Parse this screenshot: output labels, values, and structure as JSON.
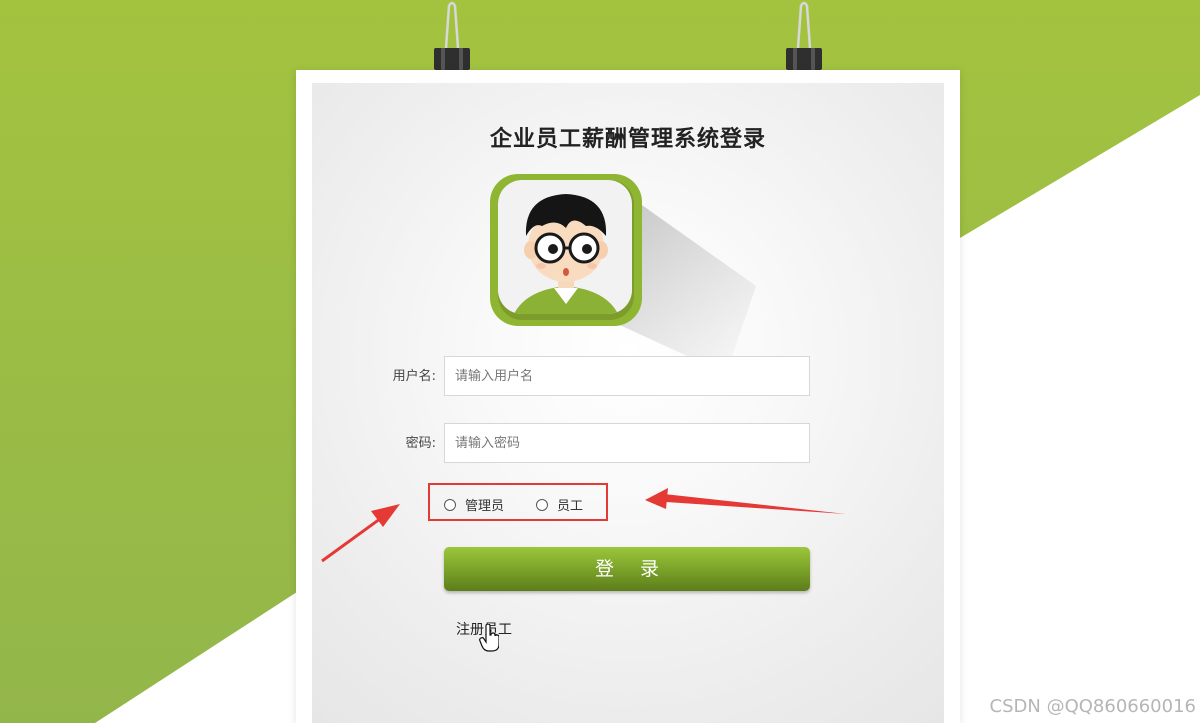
{
  "page": {
    "title": "企业员工薪酬管理系统登录"
  },
  "form": {
    "username": {
      "label": "用户名:",
      "placeholder": "请输入用户名",
      "value": ""
    },
    "password": {
      "label": "密码:",
      "placeholder": "请输入密码",
      "value": ""
    },
    "roles": [
      {
        "label": "管理员",
        "selected": false
      },
      {
        "label": "员工",
        "selected": false
      }
    ],
    "login_label": "登 录",
    "register_label": "注册员工"
  },
  "watermark": "CSDN @QQ860660016",
  "colors": {
    "brand_green": "#9dc03e",
    "button_green": "#7fa72b",
    "annotation_red": "#e53935"
  },
  "icons": {
    "avatar": "cartoon-avatar-icon",
    "clips": "binder-clip-icon",
    "cursor": "hand-pointer-icon"
  }
}
